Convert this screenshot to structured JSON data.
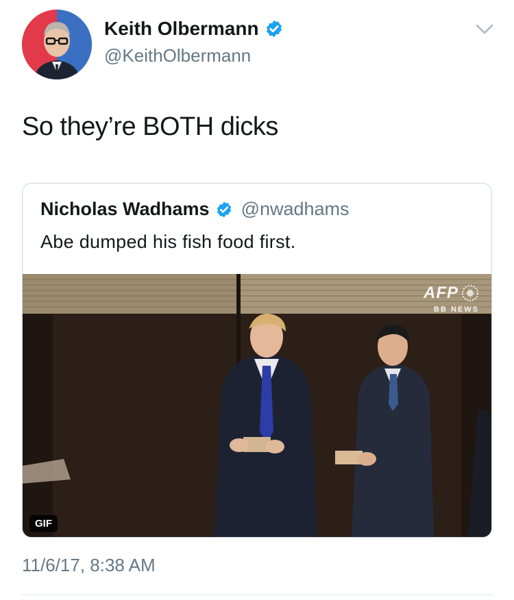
{
  "tweet": {
    "author_name": "Keith Olbermann",
    "author_handle": "@KeithOlbermann",
    "text": "So they’re BOTH dicks",
    "timestamp": "11/6/17, 8:38 AM"
  },
  "quoted_tweet": {
    "author_name": "Nicholas Wadhams",
    "author_handle": "@nwadhams",
    "text": "Abe dumped his fish food first.",
    "media": {
      "watermark": "AFP",
      "watermark_sub": "BB NEWS",
      "badge": "GIF"
    }
  },
  "colors": {
    "verified": "#1da1f2",
    "secondary_text": "#657786",
    "border": "#ccd6dd"
  },
  "icons": [
    "verified-badge-icon",
    "chevron-down-icon"
  ]
}
